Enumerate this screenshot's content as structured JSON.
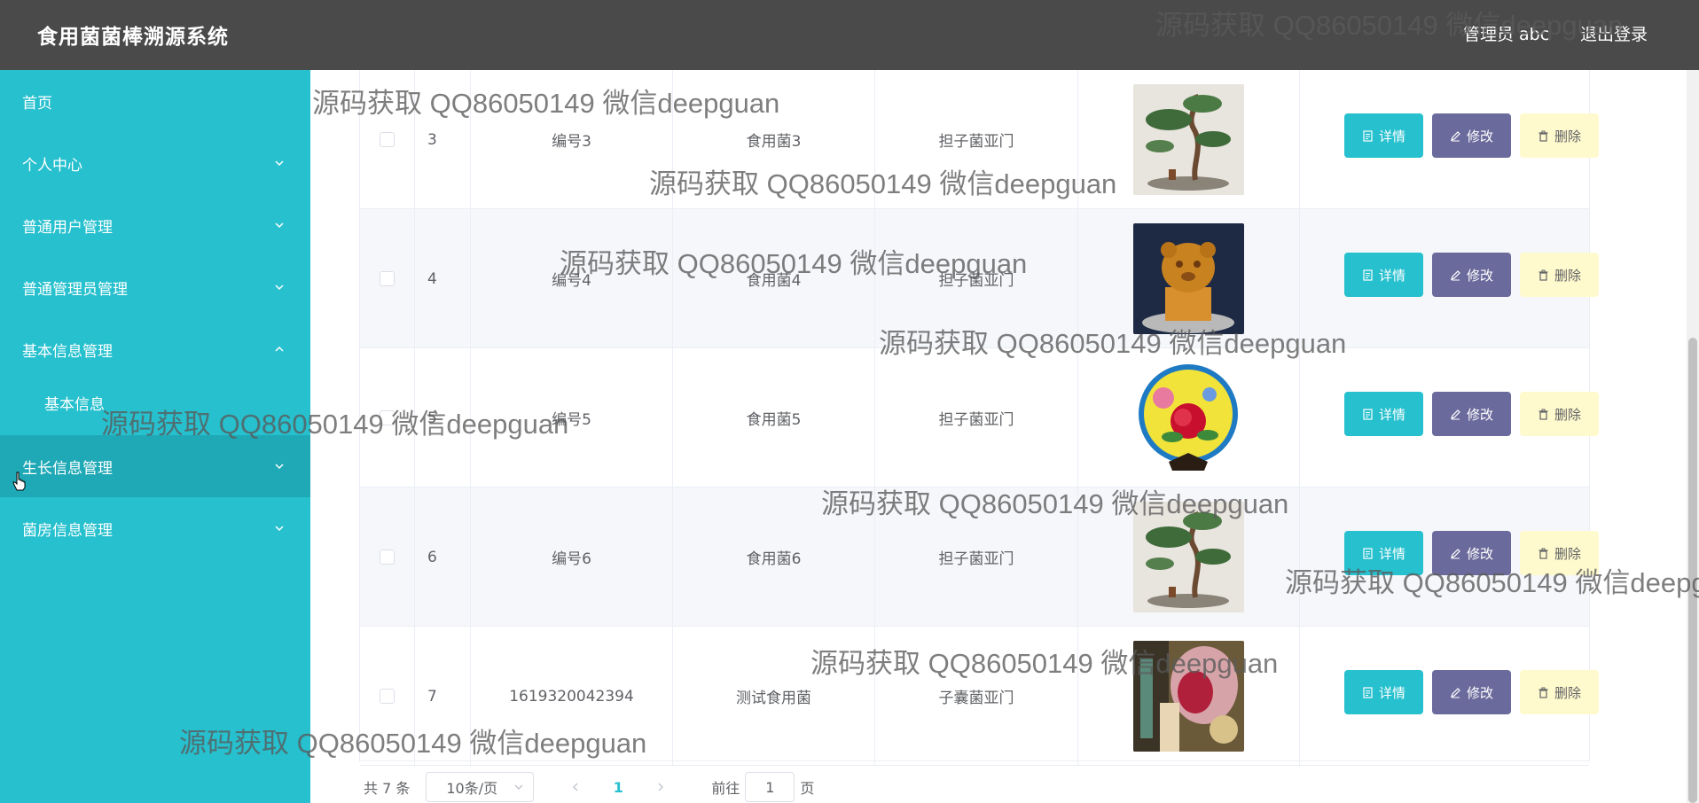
{
  "header": {
    "app_title": "食用菌菌棒溯源系统",
    "user_label": "管理员 abc",
    "logout_label": "退出登录"
  },
  "sidebar": {
    "items": [
      {
        "label": "首页",
        "arrow": "none"
      },
      {
        "label": "个人中心",
        "arrow": "down"
      },
      {
        "label": "普通用户管理",
        "arrow": "down"
      },
      {
        "label": "普通管理员管理",
        "arrow": "down"
      },
      {
        "label": "基本信息管理",
        "arrow": "up"
      },
      {
        "label": "基本信息",
        "arrow": "none"
      },
      {
        "label": "生长信息管理",
        "arrow": "down"
      },
      {
        "label": "菌房信息管理",
        "arrow": "down"
      }
    ]
  },
  "table": {
    "rows": [
      {
        "index": "3",
        "code": "编号3",
        "name": "食用菌3",
        "classification": "担子菌亚门",
        "image_icon": "bonsai-pine-image"
      },
      {
        "index": "4",
        "code": "编号4",
        "name": "食用菌4",
        "classification": "担子菌亚门",
        "image_icon": "lion-seal-image"
      },
      {
        "index": "5",
        "code": "编号5",
        "name": "食用菌5",
        "classification": "担子菌亚门",
        "image_icon": "peony-plate-image"
      },
      {
        "index": "6",
        "code": "编号6",
        "name": "食用菌6",
        "classification": "担子菌亚门",
        "image_icon": "bonsai-pine-image"
      },
      {
        "index": "7",
        "code": "1619320042394",
        "name": "测试食用菌",
        "classification": "子囊菌亚门",
        "image_icon": "abstract-photo-image"
      }
    ],
    "buttons": {
      "detail_label": "详情",
      "edit_label": "修改",
      "delete_label": "删除"
    }
  },
  "pagination": {
    "total_label": "共 7 条",
    "page_size": "10条/页",
    "current_page": "1",
    "goto_label": "前往",
    "goto_value": "1",
    "page_unit": "页"
  },
  "watermark": {
    "text": "源码获取 QQ86050149 微信deepguan"
  },
  "colors": {
    "header_bg": "#4a4a4a",
    "sidebar_bg": "#26c0ce",
    "sidebar_hover": "#1fa9b6",
    "detail_btn": "#26c0ce",
    "edit_btn": "#6b6a9c",
    "delete_btn": "#fffacd",
    "accent": "#26c0ce"
  }
}
